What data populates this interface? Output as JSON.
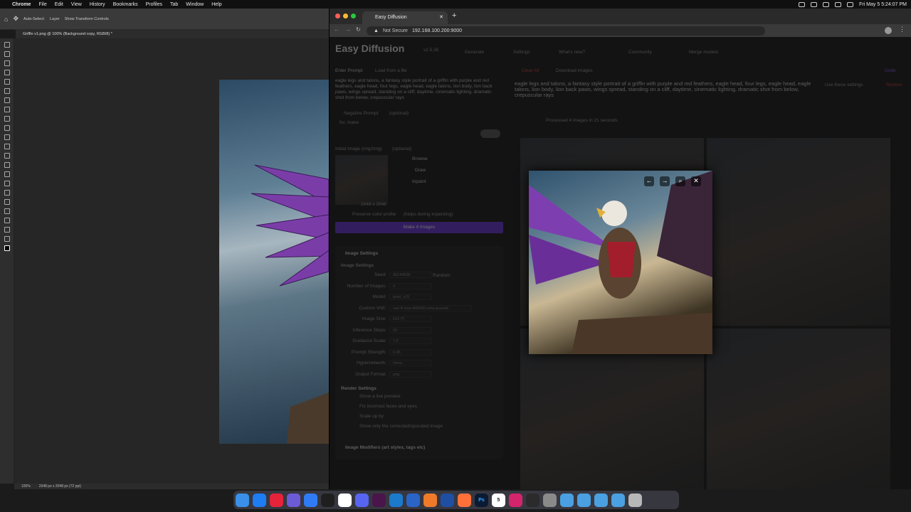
{
  "menubar": {
    "app": "Chrome",
    "items": [
      "File",
      "Edit",
      "View",
      "History",
      "Bookmarks",
      "Profiles",
      "Tab",
      "Window",
      "Help"
    ],
    "clock": "Fri May 5  5:24:07 PM"
  },
  "photoshop": {
    "options": {
      "auto_select": "Auto-Select:",
      "layer": "Layer",
      "transform": "Show Transform Controls"
    },
    "doc_tab": "Griffin v1.png @ 100% (Background copy, RGB/8) *",
    "status_zoom": "100%",
    "status_info": "2048 px x 2048 px (72 ppi)"
  },
  "chrome": {
    "tab_title": "Easy Diffusion",
    "not_secure": "Not Secure",
    "url": "192.168.100.200:9000"
  },
  "app": {
    "title": "Easy Diffusion",
    "version": "v2.5.35",
    "nav": [
      "Generate",
      "Settings",
      "What's new?",
      "Community",
      "Merge models"
    ],
    "prompt_label": "Enter Prompt",
    "load_file": "Load from a file",
    "prompt_text": "eagle legs and talons, a fantasy style portrait of a griffin with purple and red feathers, eagle head, four legs, eagle head, eagle talons, lion body, lion back paws, wings spread, standing on a cliff, daytime, cinematic lighting, dramatic shot from below, crepuscular rays",
    "negative_label": "Negative Prompt",
    "negative_hint": "(optional)",
    "negative_text": "fur, mane",
    "initial_image_label": "Initial Image (img2img)",
    "initial_image_hint": "(optional)",
    "browse": "Browse",
    "draw": "Draw",
    "inpaint": "Inpaint",
    "init_size": "2048 x 2048",
    "preserve_color": "Preserve color profile",
    "preserve_hint": "(helps during inpainting)",
    "make_button": "Make 4 Images",
    "settings_title": "Image Settings",
    "settings_sub": "Image Settings",
    "rows": [
      {
        "label": "Seed:",
        "value": "30144508"
      },
      {
        "label": "Number of Images:",
        "value": "4"
      },
      {
        "label": "Model:",
        "value": "lyriel_v15"
      },
      {
        "label": "Custom VAE:",
        "value": "vae-ft-mse-840000-ema-pruned"
      },
      {
        "label": "Image Size:",
        "value": "512 (*)"
      },
      {
        "label": "Inference Steps:",
        "value": "25"
      },
      {
        "label": "Guidance Scale:",
        "value": "7.5"
      },
      {
        "label": "Prompt Strength:",
        "value": "0.95"
      },
      {
        "label": "Hypernetwork:",
        "value": "None"
      },
      {
        "label": "Output Format:",
        "value": "png"
      }
    ],
    "random": "Random",
    "render_title": "Render Settings",
    "render_options": [
      "Show a live preview",
      "Fix incorrect faces and eyes",
      "Scale up by",
      "Show only the corrected/upscaled image"
    ],
    "modifiers_title": "Image Modifiers (art styles, tags etc)",
    "clear_all": "Clear All",
    "download": "Download images",
    "undo": "Undo",
    "result_prompt": "eagle legs and talons, a fantasy style portrait of a griffin with purple and red feathers, eagle head, four legs, eagle head, eagle talons, lion body, lion back paws, wings spread, standing on a cliff, daytime, cinematic lighting, dramatic shot from below, crepuscular rays",
    "use_settings": "Use these settings",
    "rerun": "Restore",
    "processed": "Processed 4 images in 21 seconds"
  },
  "lightbox": {
    "prev": "←",
    "next": "→",
    "zoom": "⌕",
    "close": "✕"
  },
  "dock": [
    "Finder",
    "App Store",
    "Opera",
    "Hand",
    "Messenger",
    "Terminal",
    "Chrome",
    "Discord",
    "Slack",
    "VS Code",
    "Sourcetree",
    "Vector",
    "Q",
    "Firefox",
    "Ps",
    "Calendar",
    "Affinity",
    "Display",
    "Monitor",
    "Folder",
    "Folder",
    "Folder",
    "Folder",
    "Trash"
  ],
  "dock_calendar": "5",
  "colors": {
    "accent": "#5b2dbf",
    "danger": "#b03636",
    "dock": "#3c3c46"
  }
}
